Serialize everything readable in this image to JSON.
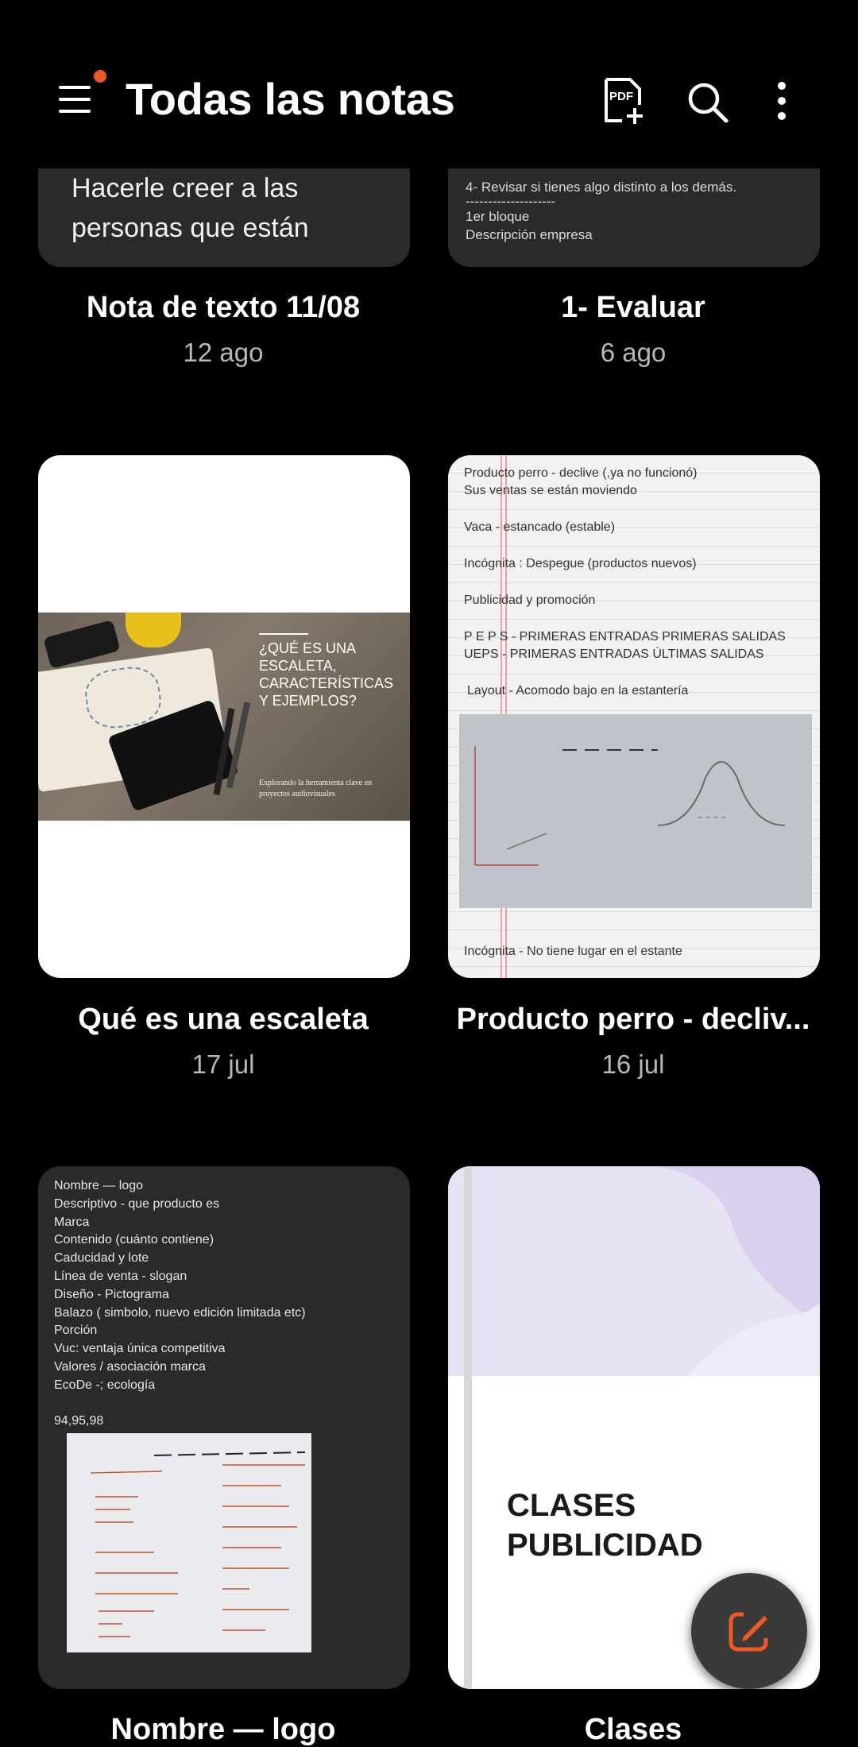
{
  "header": {
    "title": "Todas las notas",
    "icons": [
      "menu-icon",
      "pdf-add-icon",
      "search-icon",
      "more-vert-icon"
    ],
    "notification_color": "#f05a22"
  },
  "notes": [
    {
      "title": "Nota de texto 11/08",
      "date": "12 ago",
      "preview_lines": [
        "Hacerle creer a las",
        "personas que están"
      ]
    },
    {
      "title": "1- Evaluar",
      "date": "6 ago",
      "preview_lines": [
        "4- Revisar si tienes algo distinto a los demás.",
        "--------------------",
        "1er bloque",
        "Descripción empresa"
      ]
    },
    {
      "title": "Qué es una escaleta",
      "date": "17 jul",
      "image_heading": "¿QUÉ ES UNA ESCALETA, CARACTERÍSTICAS Y EJEMPLOS?",
      "image_caption": "Explorando la herramienta clave en proyectos audiovisuales"
    },
    {
      "title": "Producto perro - decliv...",
      "date": "16 jul",
      "preview_lines": [
        "Producto perro - declive (,ya no funcionó)",
        "Sus ventas se están moviendo",
        "Vaca - estancado (estable)",
        "Incógnita : Despegue (productos nuevos)",
        "Publicidad y promoción",
        "P E P S - PRIMERAS ENTRADAS PRIMERAS SALIDAS",
        "UEPS - PRIMERAS ENTRADAS ÚLTIMAS SALIDAS",
        "Layout - Acomodo bajo en la estantería",
        "Incógnita - No tiene lugar en el estante"
      ]
    },
    {
      "title": "Nombre  — logo",
      "date": "",
      "preview_lines": [
        "Nombre  — logo",
        "Descriptivo - que producto es",
        "Marca",
        "Contenido  (cuánto contiene)",
        "Caducidad y lote",
        "Línea de venta  - slogan",
        "Diseño - Pictograma",
        "Balazo ( simbolo, nuevo edición limitada etc)",
        "Porción",
        "Vuc: ventaja única competitiva",
        "Valores / asociación marca",
        "EcoDe -; ecología",
        "",
        "94,95,98"
      ]
    },
    {
      "title": "Clases",
      "date": "",
      "cover_text": [
        "CLASES",
        "PUBLICIDAD"
      ]
    }
  ],
  "fab": {
    "icon": "edit-note-icon",
    "color": "#f05a22"
  }
}
